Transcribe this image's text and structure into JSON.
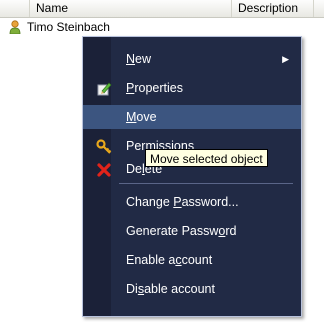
{
  "list": {
    "columns": [
      "Name",
      "Description"
    ],
    "rows": [
      {
        "name": "Timo Steinbach",
        "icon": "user-icon"
      }
    ]
  },
  "menu": {
    "items": [
      {
        "label": "New",
        "accel": "N",
        "has_submenu": true
      },
      {
        "label": "Properties",
        "accel": "P",
        "icon": "properties-icon"
      },
      {
        "label": "Move",
        "accel": "M",
        "highlighted": true
      },
      {
        "label": "Permissions",
        "accel": "",
        "icon": "key-icon"
      },
      {
        "label": "Delete",
        "accel": "l",
        "icon": "delete-icon"
      },
      {
        "label": "Change Password...",
        "accel": "P"
      },
      {
        "label": "Generate Password",
        "accel": "o"
      },
      {
        "label": "Enable account",
        "accel": "c"
      },
      {
        "label": "Disable account",
        "accel": "s"
      }
    ]
  },
  "tooltip": "Move selected object",
  "colors": {
    "menu_bg": "#212a45",
    "highlight": "#3c5580",
    "tooltip_bg": "#ffffe1"
  }
}
